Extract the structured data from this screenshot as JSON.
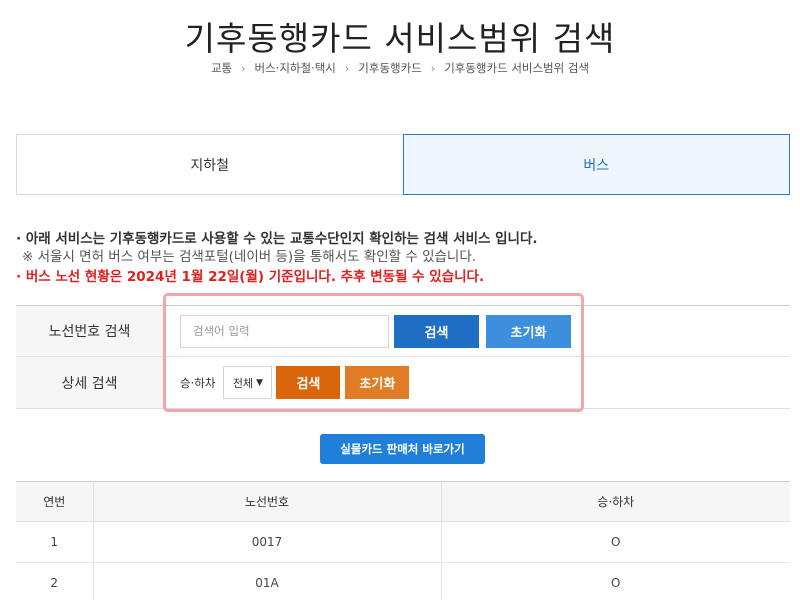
{
  "page": {
    "title": "기후동행카드 서비스범위 검색"
  },
  "breadcrumb": {
    "items": [
      "교통",
      "버스·지하철·택시",
      "기후동행카드",
      "기후동행카드 서비스범위 검색"
    ],
    "separator": "›"
  },
  "tabs": [
    {
      "label": "지하철",
      "active": false
    },
    {
      "label": "버스",
      "active": true
    }
  ],
  "notice": {
    "line1": "· 아래 서비스는 기후동행카드로 사용할 수 있는 교통수단인지 확인하는 검색 서비스 입니다.",
    "line2": "※ 서울시 면허 버스 여부는 검색포털(네이버 등)을 통해서도 확인할 수 있습니다.",
    "line3": "· 버스 노선 현황은 2024년 1월 22일(월) 기준입니다. 추후 변동될 수 있습니다."
  },
  "search": {
    "route_label": "노선번호 검색",
    "route_placeholder": "검색어 입력",
    "route_value": "",
    "search_button": "검색",
    "reset_button": "초기화",
    "detail_label": "상세 검색",
    "stop_label": "승·하차",
    "stop_selected": "전체",
    "detail_search_button": "검색",
    "detail_reset_button": "초기화"
  },
  "shop_button": "실물카드 판매처 바로가기",
  "results": {
    "headers": [
      "연번",
      "노선번호",
      "승·하차"
    ],
    "rows": [
      [
        "1",
        "0017",
        "O"
      ],
      [
        "2",
        "01A",
        "O"
      ]
    ]
  },
  "colors": {
    "primary_blue": "#1f6fc5",
    "light_blue": "#3d8fde",
    "orange": "#d9660b",
    "light_orange": "#e07b26",
    "notice_red": "#e02020",
    "highlight_pink": "#f2a5ab"
  },
  "icons": {
    "select_arrow": "chevron-down-icon"
  }
}
